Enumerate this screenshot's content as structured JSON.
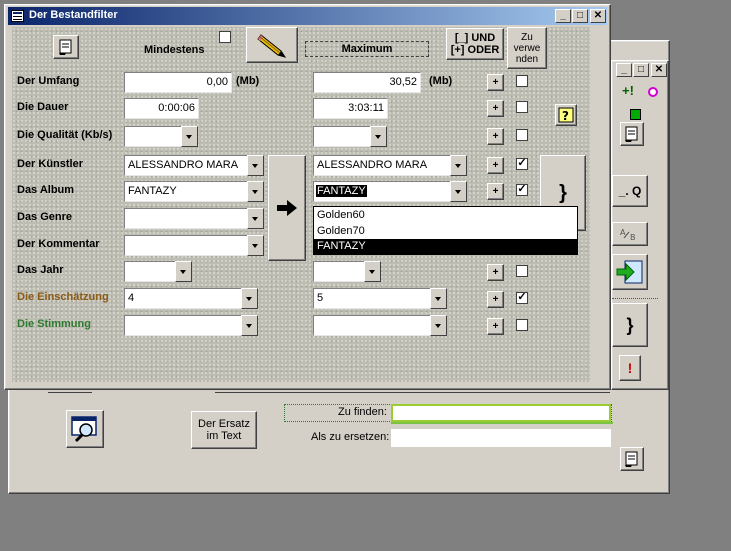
{
  "main_window": {
    "title": "Der Bestandfilter",
    "controls": {
      "minimize": "_",
      "maximize": "□",
      "close": "✕"
    },
    "header": {
      "mindestens": "Mindestens",
      "maximum": "Maximum",
      "und_oder": "[_] UND\n[+] ODER",
      "zu_verwenden": "Zu\nverwe\nnden"
    },
    "rows": [
      {
        "label": "Der Umfang",
        "min": "0,00",
        "min_unit": "(Mb)",
        "max": "30,52",
        "max_unit": "(Mb)",
        "checked": false
      },
      {
        "label": "Die Dauer",
        "min": "0:00:06",
        "max": "3:03:11",
        "checked": false
      },
      {
        "label": "Die Qualität (Kb/s)",
        "min": "",
        "max": "",
        "checked": false
      },
      {
        "label": "Der Künstler",
        "min": "ALESSANDRO MARA",
        "max": "ALESSANDRO MARA",
        "checked": true
      },
      {
        "label": "Das Album",
        "min": "FANTAZY",
        "max": "FANTAZY",
        "checked": true
      },
      {
        "label": "Das Genre",
        "min": "",
        "max": "",
        "checked": false
      },
      {
        "label": "Der Kommentar",
        "min": "",
        "max": "",
        "checked": false
      },
      {
        "label": "Das Jahr",
        "min": "",
        "max": "",
        "checked": false
      },
      {
        "label": "Die Einschätzung",
        "min": "4",
        "max": "5",
        "checked": true
      },
      {
        "label": "Die Stimmung",
        "min": "",
        "max": "",
        "checked": false
      }
    ],
    "plus_label": "+",
    "dropdown_options": [
      "Golden60",
      "Golden70",
      "FANTAZY"
    ],
    "dropdown_selected": "FANTAZY",
    "help_label": "?",
    "brace_label": "}"
  },
  "colors": {
    "einschaetzung": "#8b5a14",
    "stimmung": "#2f7a2f",
    "titlebar": "#0a246a",
    "selection": "#000000"
  },
  "back_window": {
    "ersatz_button": "Der Ersatz\nim Text",
    "zu_finden_label": "Zu finden:",
    "zu_finden_value": "",
    "ersetzen_label": "Als zu ersetzen:",
    "ersetzen_value": ""
  },
  "side_panel": {
    "q_button": "_. Q",
    "brace_button": "}",
    "exclaim_button": "!",
    "plus_excl": "+!"
  }
}
